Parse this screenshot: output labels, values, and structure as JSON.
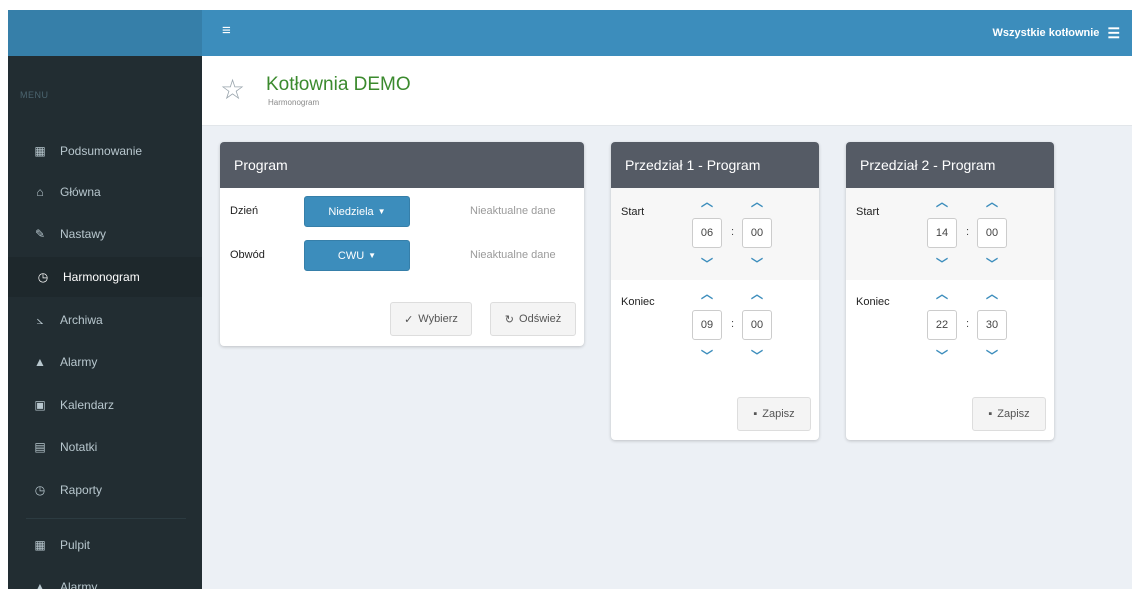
{
  "topbar": {
    "all_boilers_label": "Wszystkie kotłownie",
    "menu_icon": "hamburger-icon",
    "list_icon": "list-icon",
    "color": "#3c8dbc"
  },
  "sidebar": {
    "header": "MENU",
    "items": [
      {
        "label": "Podsumowanie",
        "icon": "dashboard-icon"
      },
      {
        "label": "Główna",
        "icon": "home-icon"
      },
      {
        "label": "Nastawy",
        "icon": "wrench-icon"
      },
      {
        "label": "Harmonogram",
        "icon": "clock-icon",
        "active": true
      },
      {
        "label": "Archiwa",
        "icon": "line-chart-icon"
      },
      {
        "label": "Alarmy",
        "icon": "warning-icon"
      },
      {
        "label": "Kalendarz",
        "icon": "calendar-icon"
      },
      {
        "label": "Notatki",
        "icon": "clipboard-icon"
      },
      {
        "label": "Raporty",
        "icon": "clock-icon"
      },
      {
        "label": "Pulpit",
        "icon": "dashboard-icon"
      },
      {
        "label": "Alarmy",
        "icon": "warning-icon"
      }
    ]
  },
  "header": {
    "title": "Kotłownia DEMO",
    "subtitle": "Harmonogram",
    "star_icon": "star-icon"
  },
  "program_panel": {
    "title": "Program",
    "day_label": "Dzień",
    "day_value": "Niedziela",
    "day_status": "Nieaktualne dane",
    "circuit_label": "Obwód",
    "circuit_value": "CWU",
    "circuit_status": "Nieaktualne dane",
    "select_label": "Wybierz",
    "refresh_label": "Odśwież"
  },
  "zones": [
    {
      "title": "Przedział 1 - Program",
      "start_label": "Start",
      "start_hour": "06",
      "start_min": "00",
      "end_label": "Koniec",
      "end_hour": "09",
      "end_min": "00",
      "save_label": "Zapisz"
    },
    {
      "title": "Przedział 2 - Program",
      "start_label": "Start",
      "start_hour": "14",
      "start_min": "00",
      "end_label": "Koniec",
      "end_hour": "22",
      "end_min": "30",
      "save_label": "Zapisz"
    }
  ],
  "time_separator": ":"
}
